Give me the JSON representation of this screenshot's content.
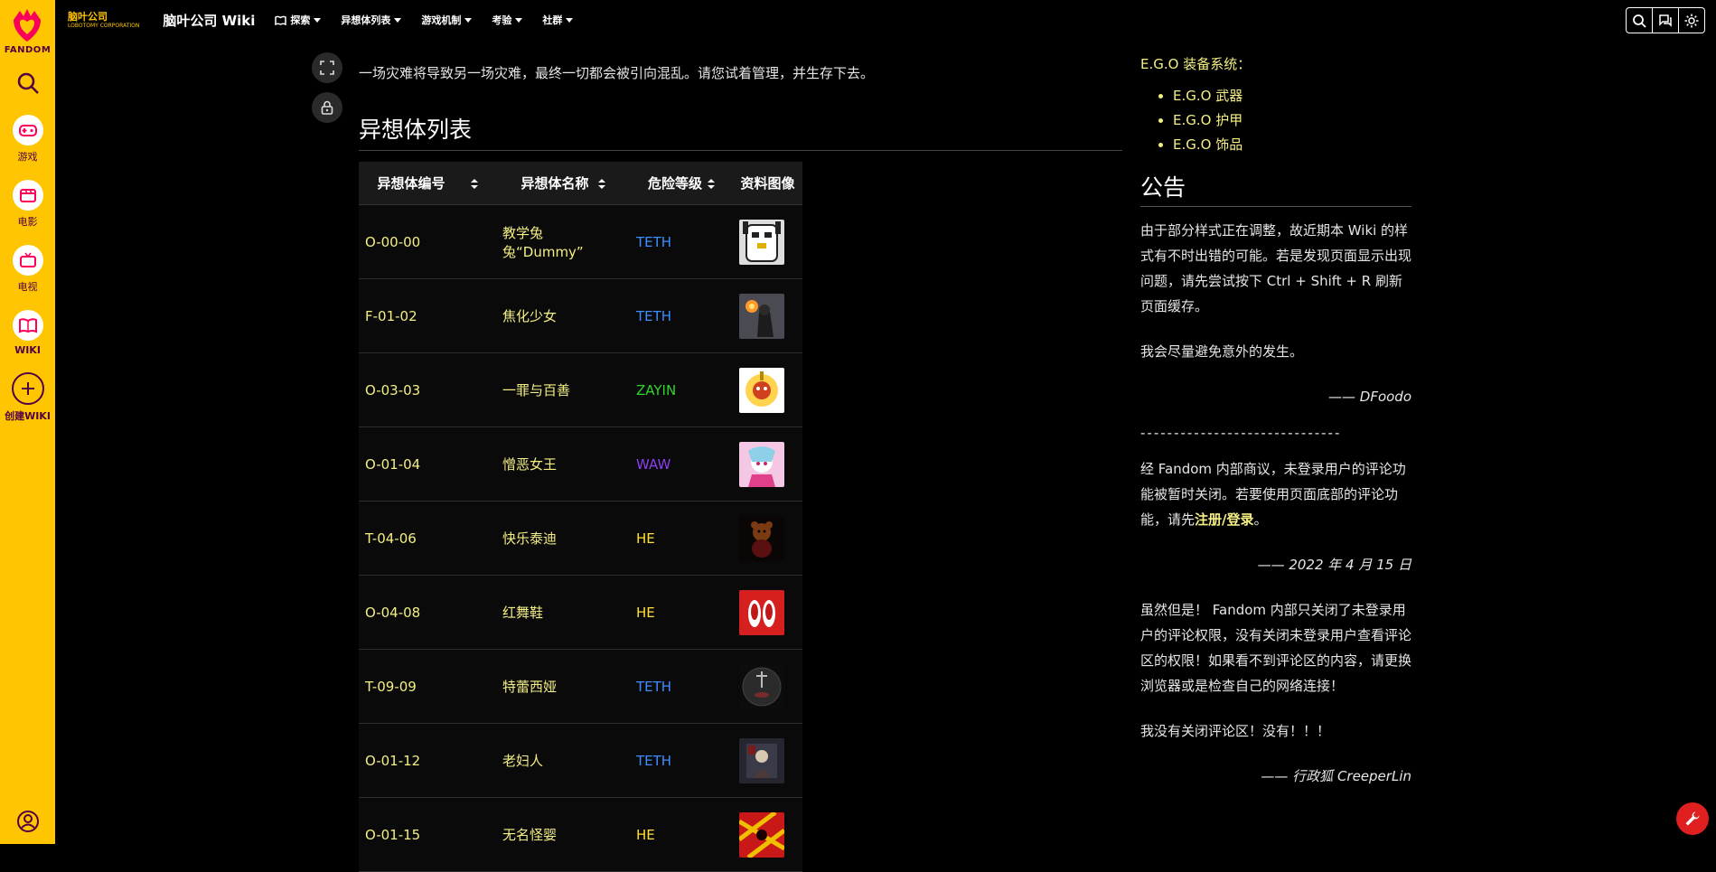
{
  "rail": {
    "brand": "FANDOM",
    "items": [
      {
        "label": "游戏"
      },
      {
        "label": "电影"
      },
      {
        "label": "电视"
      },
      {
        "label": "WIKI"
      },
      {
        "label": "创建WIKI"
      }
    ]
  },
  "header": {
    "logo_line1": "脑叶公司",
    "logo_line2": "LOBOTOMY CORPORATION",
    "site_name": "脑叶公司 Wiki",
    "nav": [
      "探索",
      "异想体列表",
      "游戏机制",
      "考验",
      "社群"
    ]
  },
  "main": {
    "intro": "一场灾难将导致另一场灾难，最终一切都会被引向混乱。请您试着管理，并生存下去。",
    "section_title": "异想体列表",
    "table": {
      "headers": [
        "异想体编号",
        "异想体名称",
        "危险等级",
        "资料图像"
      ],
      "rows": [
        {
          "code": "O-00-00",
          "name": "教学兔兔“Dummy”",
          "risk": "TETH",
          "img": "dummy-rabbit-image"
        },
        {
          "code": "F-01-02",
          "name": "焦化少女",
          "risk": "TETH",
          "img": "scorched-girl-image"
        },
        {
          "code": "O-03-03",
          "name": "一罪与百善",
          "risk": "ZAYIN",
          "img": "one-sin-image"
        },
        {
          "code": "O-01-04",
          "name": "憎恶女王",
          "risk": "WAW",
          "img": "queen-of-hatred-image"
        },
        {
          "code": "T-04-06",
          "name": "快乐泰迪",
          "risk": "HE",
          "img": "happy-teddy-image"
        },
        {
          "code": "O-04-08",
          "name": "红舞鞋",
          "risk": "HE",
          "img": "red-shoes-image"
        },
        {
          "code": "T-09-09",
          "name": "特蕾西娅",
          "risk": "TETH",
          "img": "theresia-image"
        },
        {
          "code": "O-01-12",
          "name": "老妇人",
          "risk": "TETH",
          "img": "old-lady-image"
        },
        {
          "code": "O-01-15",
          "name": "无名怪婴",
          "risk": "HE",
          "img": "nameless-fetus-image"
        }
      ]
    }
  },
  "sidebar": {
    "ego_heading": "E.G.O 装备系统：",
    "ego_items": [
      "E.G.O 武器",
      "E.G.O 护甲",
      "E.G.O 饰品"
    ],
    "announce_title": "公告",
    "p1": "由于部分样式正在调整，故近期本 Wiki 的样式有不时出错的可能。若是发现页面显示出现问题，请先尝试按下 Ctrl + Shift + R 刷新页面缓存。",
    "p2": "我会尽量避免意外的发生。",
    "sig1": "—— DFoodo",
    "divider": "------------------------------",
    "p3_a": "经 Fandom 内部商议，未登录用户的评论功能被暂时关闭。若要使用页面底部的评论功能，请先",
    "p3_link": "注册/登录",
    "p3_b": "。",
    "sig2": "—— 2022 年 4 月 15 日",
    "p4": "虽然但是！ Fandom 内部只关闭了未登录用户的评论权限，没有关闭未登录用户查看评论区的权限！如果看不到评论区的内容，请更换浏览器或是检查自己的网络连接！",
    "p5": "我没有关闭评论区！没有！！！",
    "sig3": "—— 行政狐 CreeperLin"
  },
  "colors": {
    "rail": "#ffc500",
    "link": "#f4ee84",
    "TETH": "#3e8eff",
    "ZAYIN": "#2ed52e",
    "WAW": "#8c3ff0",
    "HE": "#ffe033"
  }
}
